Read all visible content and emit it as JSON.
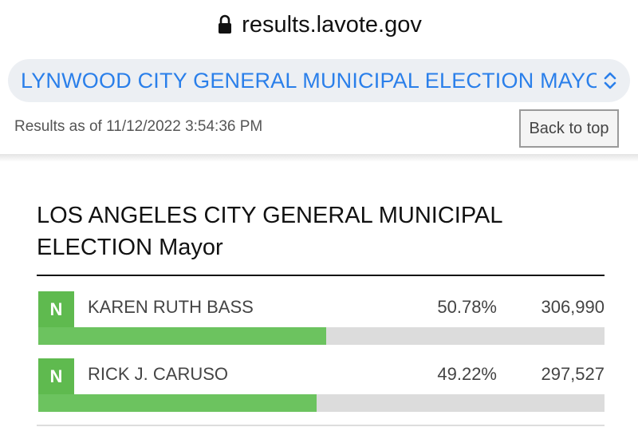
{
  "browser": {
    "url": "results.lavote.gov"
  },
  "election_selector": {
    "selected": "LYNWOOD CITY GENERAL MUNICIPAL ELECTION MAYOR"
  },
  "status": {
    "results_as_of": "Results as of 11/12/2022 3:54:36 PM",
    "back_to_top_label": "Back to top"
  },
  "contest": {
    "title": "LOS ANGELES CITY GENERAL MUNICIPAL ELECTION Mayor",
    "candidates": [
      {
        "badge": "N",
        "name": "KAREN RUTH BASS",
        "percent": "50.78%",
        "votes": "306,990",
        "share": 0.5078
      },
      {
        "badge": "N",
        "name": "RICK J. CARUSO",
        "percent": "49.22%",
        "votes": "297,527",
        "share": 0.4922
      }
    ]
  },
  "colors": {
    "accent": "#2a7fea",
    "bar_fill": "#6cc35f",
    "badge": "#5fba4f",
    "bar_track": "#dcdcdc"
  }
}
